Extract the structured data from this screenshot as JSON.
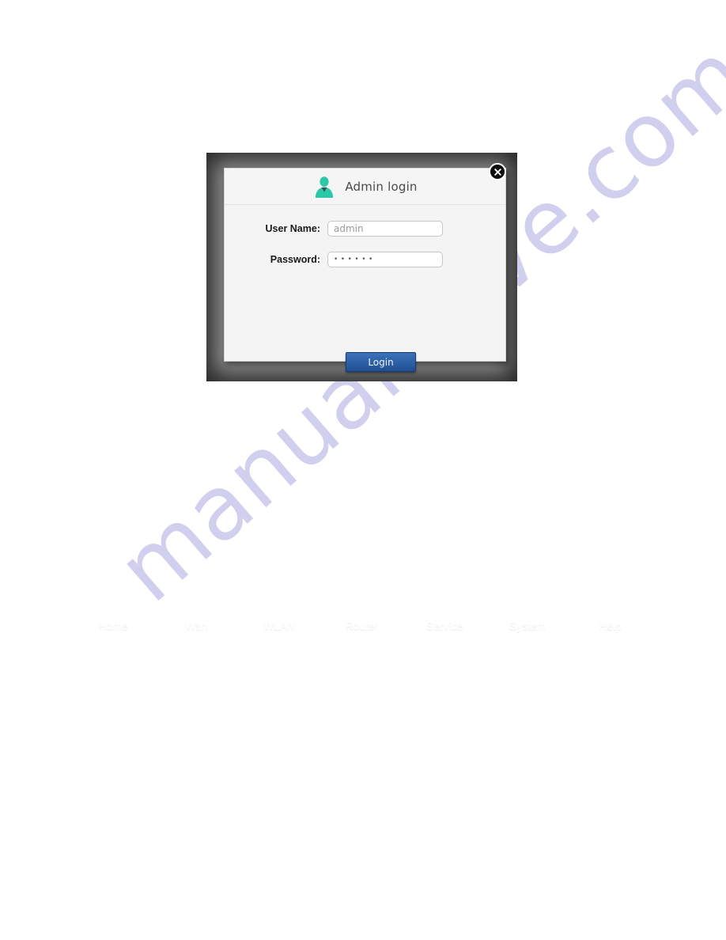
{
  "watermark": {
    "text": "manualshive.com",
    "color": "#a9a4e0"
  },
  "dialog": {
    "title": "Admin login",
    "avatar_icon": "user-avatar-icon",
    "close_icon": "close-circle-icon",
    "fields": [
      {
        "label": "User Name:",
        "value": "admin",
        "placeholder": "admin",
        "type": "text"
      },
      {
        "label": "Password:",
        "value": "••••••",
        "placeholder": "",
        "type": "password"
      }
    ],
    "submit_label": "Login",
    "colors": {
      "frame": "#8d8d8d",
      "surface": "#f4f4f4",
      "avatar": "#2bc9a7",
      "button_top": "#3c72b8",
      "button_bottom": "#1f4f91"
    }
  },
  "nav": {
    "items": [
      {
        "label": "Home"
      },
      {
        "label": "Wan"
      },
      {
        "label": "WLAN"
      },
      {
        "label": "Router"
      },
      {
        "label": "Service"
      },
      {
        "label": "System"
      },
      {
        "label": "Help"
      }
    ],
    "colors": {
      "start": "#1174d2",
      "end": "#29a8ed",
      "text": "#ffffff"
    }
  }
}
